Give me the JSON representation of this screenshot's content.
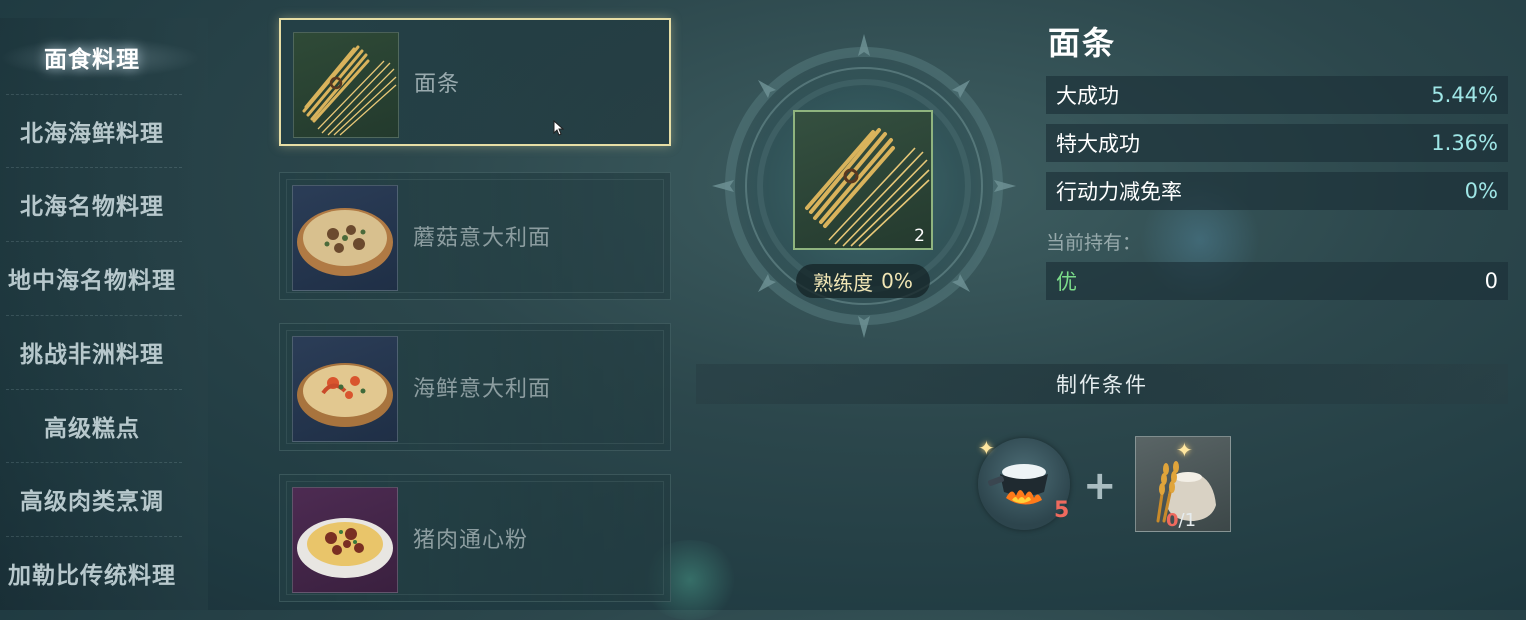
{
  "categories": [
    {
      "label": "面食料理",
      "active": true
    },
    {
      "label": "北海海鲜料理",
      "active": false
    },
    {
      "label": "北海名物料理",
      "active": false
    },
    {
      "label": "地中海名物料理",
      "active": false
    },
    {
      "label": "挑战非洲料理",
      "active": false
    },
    {
      "label": "高级糕点",
      "active": false
    },
    {
      "label": "高级肉类烹调",
      "active": false
    },
    {
      "label": "加勒比传统料理",
      "active": false
    }
  ],
  "recipes": [
    {
      "name": "面条",
      "selected": true,
      "thumb_bg": "green",
      "icon": "noodles-icon"
    },
    {
      "name": "蘑菇意大利面",
      "selected": false,
      "thumb_bg": "blue",
      "icon": "mushroom-pasta-icon"
    },
    {
      "name": "海鲜意大利面",
      "selected": false,
      "thumb_bg": "blue",
      "icon": "seafood-pasta-icon"
    },
    {
      "name": "猪肉通心粉",
      "selected": false,
      "thumb_bg": "purple",
      "icon": "pork-macaroni-icon"
    }
  ],
  "selected_item": {
    "count": "2",
    "proficiency_label": "熟练度",
    "proficiency_value": "0%"
  },
  "detail": {
    "title": "面条",
    "stats": [
      {
        "label": "大成功",
        "value": "5.44%"
      },
      {
        "label": "特大成功",
        "value": "1.36%"
      },
      {
        "label": "行动力减免率",
        "value": "0%"
      }
    ],
    "held_label": "当前持有：",
    "held_grade": "优",
    "held_count": "0"
  },
  "conditions": {
    "title": "制作条件",
    "tool_icon": "cooking-pot-icon",
    "tool_count": "5",
    "plus": "+",
    "material_icon": "wheat-flour-icon",
    "material_have": "0",
    "material_need": "/1"
  },
  "colors": {
    "selected_border": "#e7dea5",
    "stat_value": "#9fe6e6",
    "grade": "#7bdc8a",
    "warning": "#ef6a5e"
  }
}
